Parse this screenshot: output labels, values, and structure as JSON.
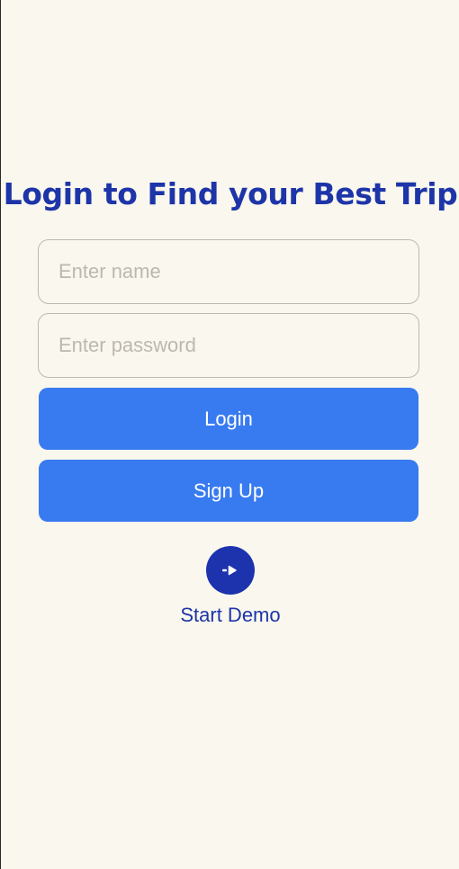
{
  "header": {
    "title": "Login to Find your Best Trip"
  },
  "form": {
    "name_placeholder": "Enter name",
    "name_value": "",
    "password_placeholder": "Enter password",
    "password_value": ""
  },
  "actions": {
    "login_label": "Login",
    "signup_label": "Sign Up",
    "demo_label": "Start Demo",
    "demo_icon": "arrow-right-to-bracket-icon"
  },
  "colors": {
    "background": "#faf7ee",
    "title": "#1d35a8",
    "button": "#387bf0",
    "demo_circle": "#1d33ad"
  }
}
